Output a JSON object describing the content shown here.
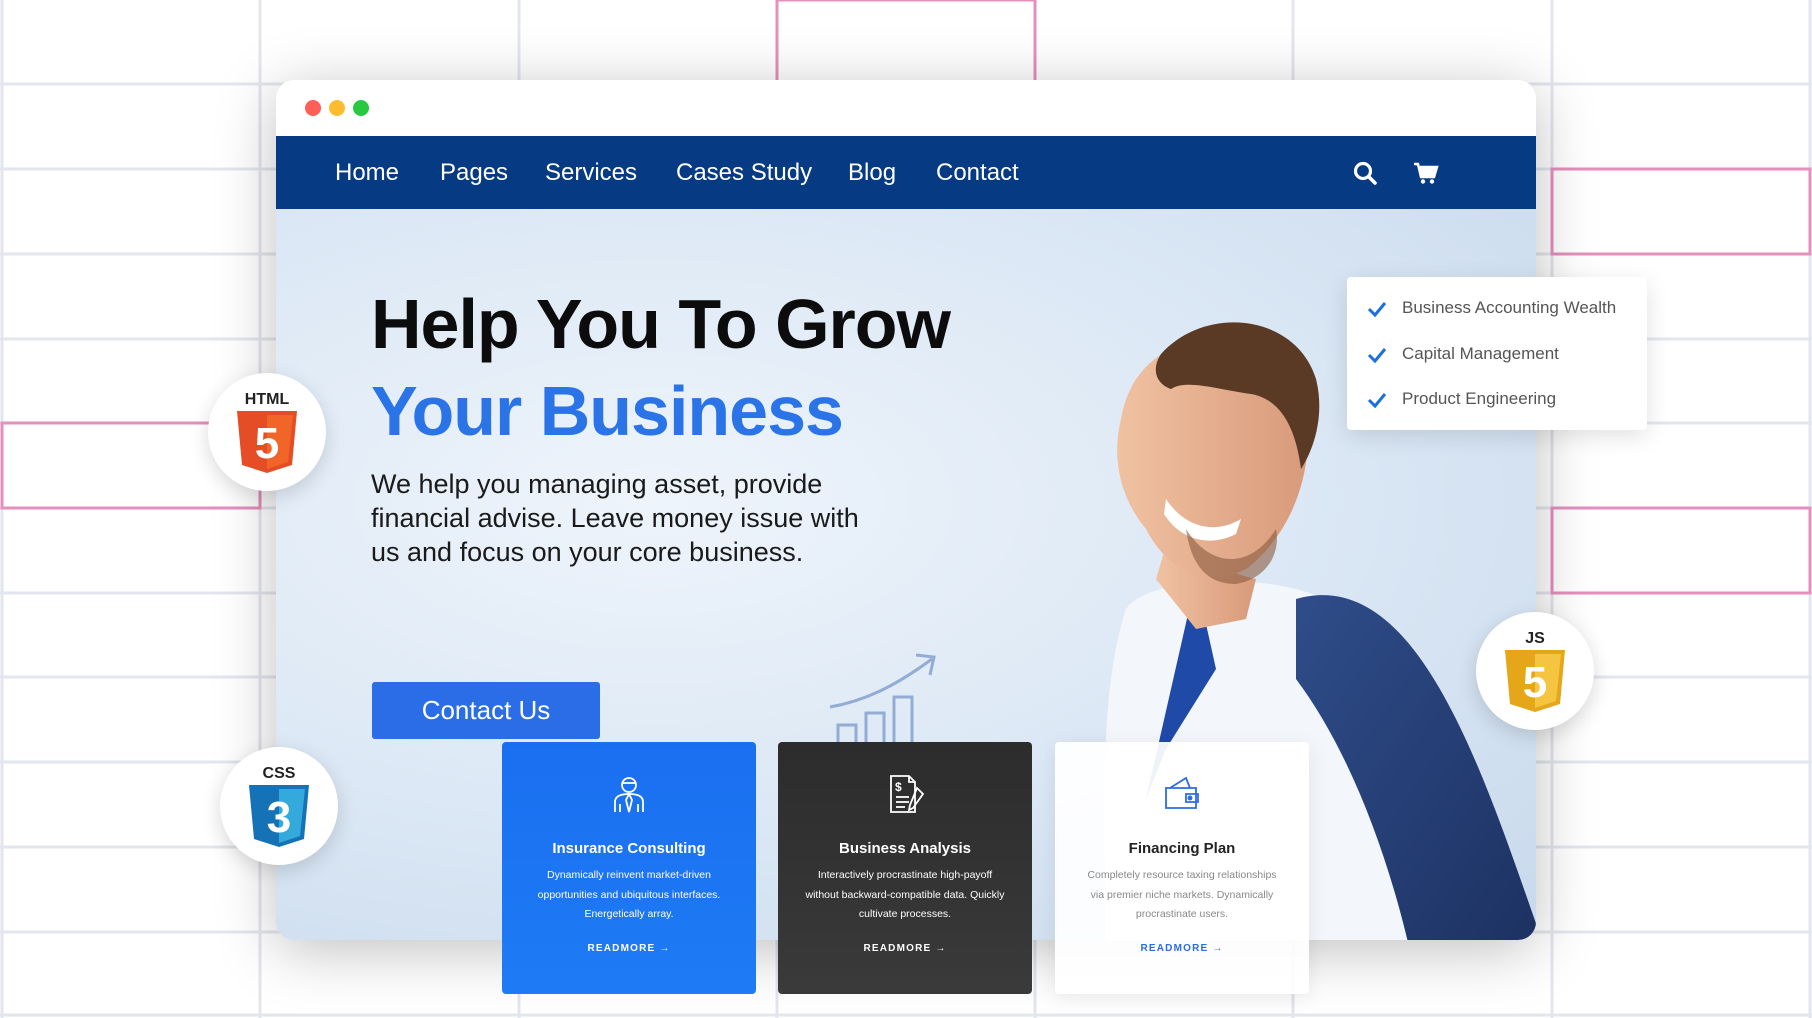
{
  "window": {
    "controls": [
      "close",
      "minimize",
      "maximize"
    ]
  },
  "nav": {
    "items": [
      {
        "label": "Home"
      },
      {
        "label": "Pages"
      },
      {
        "label": "Services"
      },
      {
        "label": "Cases Study"
      },
      {
        "label": "Blog"
      },
      {
        "label": "Contact"
      }
    ],
    "icons": [
      "search-icon",
      "cart-icon"
    ]
  },
  "hero": {
    "title_line1": "Help You To Grow",
    "title_line2": "Your Business",
    "description": "We help you managing asset, provide financial advise. Leave money issue with us and focus on your core business.",
    "cta_label": "Contact Us"
  },
  "checklist": {
    "items": [
      {
        "label": "Business Accounting Wealth"
      },
      {
        "label": "Capital Management"
      },
      {
        "label": "Product Engineering"
      }
    ]
  },
  "cards": [
    {
      "title": "Insurance Consulting",
      "description": "Dynamically reinvent market-driven opportunities and ubiquitous interfaces. Energetically array.",
      "link": "READMORE",
      "icon": "consultant-icon"
    },
    {
      "title": "Business Analysis",
      "description": "Interactively procrastinate high-payoff without backward-compatible data. Quickly cultivate processes.",
      "link": "READMORE",
      "icon": "document-icon"
    },
    {
      "title": "Financing Plan",
      "description": "Completely resource taxing relationships via premier niche markets. Dynamically procrastinate users.",
      "link": "READMORE",
      "icon": "wallet-icon"
    }
  ],
  "badges": [
    {
      "label": "HTML",
      "digit": "5"
    },
    {
      "label": "CSS",
      "digit": "3"
    },
    {
      "label": "JS",
      "digit": "5"
    }
  ],
  "colors": {
    "nav_bg": "#063a82",
    "accent": "#2a6de6",
    "html_orange": "#e44d26",
    "css_blue": "#1572b6",
    "js_gold": "#f0b429"
  }
}
